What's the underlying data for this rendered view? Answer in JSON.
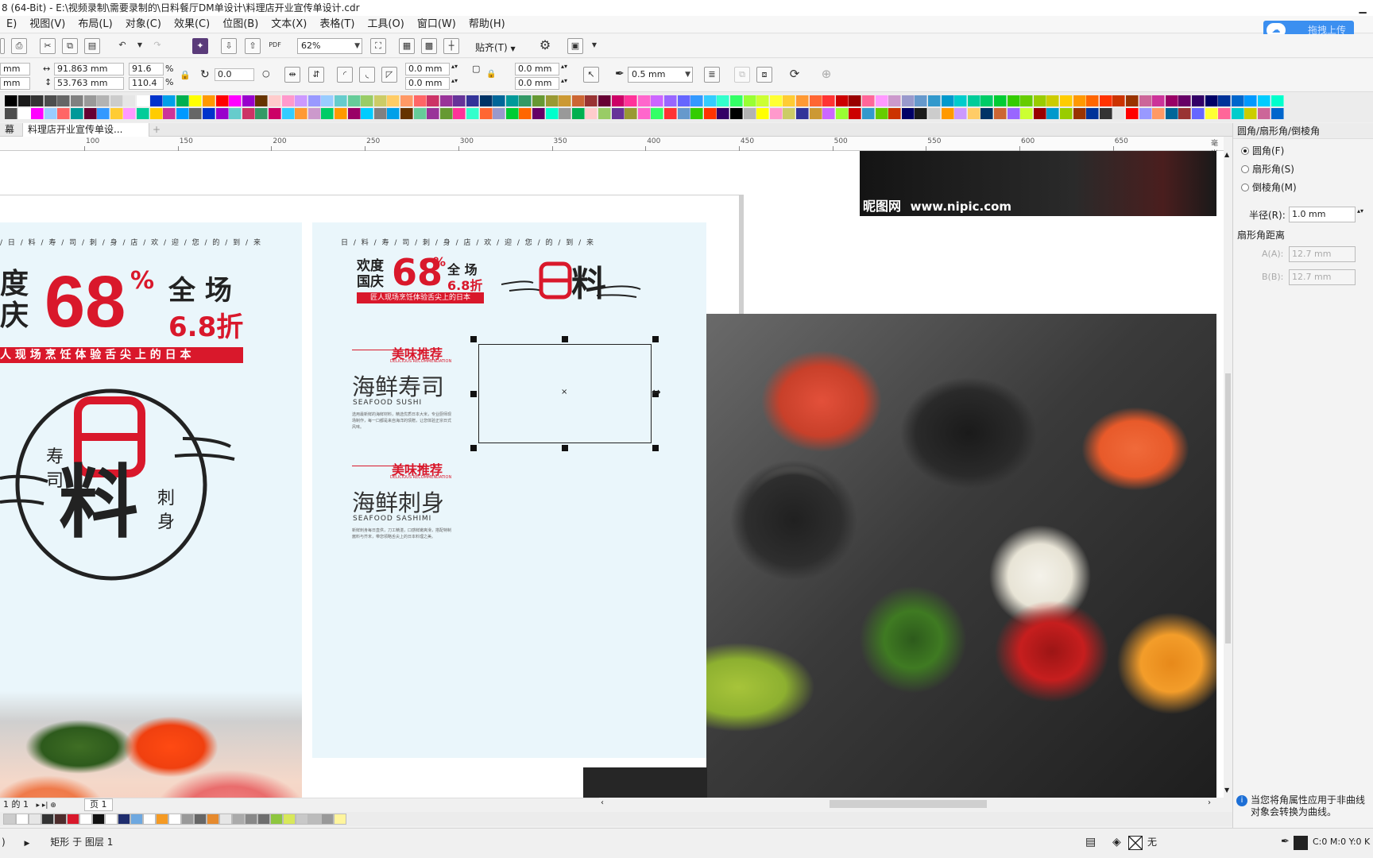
{
  "window": {
    "title": "8 (64-Bit) - E:\\视频录制\\需要录制的\\日料餐厅DM单设计\\料理店开业宣传单设计.cdr"
  },
  "menu": [
    "E)",
    "视图(V)",
    "布局(L)",
    "对象(C)",
    "效果(C)",
    "位图(B)",
    "文本(X)",
    "表格(T)",
    "工具(O)",
    "窗口(W)",
    "帮助(H)"
  ],
  "cloud_button": "拖拽上传",
  "toolbar": {
    "zoom": "62%",
    "snap_label": "贴齐(T)"
  },
  "properties": {
    "x_partial": "mm",
    "y_partial": "mm",
    "width": "91.863 mm",
    "height": "53.763 mm",
    "scale_x": "91.6",
    "scale_y": "110.4",
    "percent": "%",
    "rotation": "0.0",
    "corner_tl": "0.0 mm",
    "corner_bl": "0.0 mm",
    "corner_tr": "0.0 mm",
    "corner_br": "0.0 mm",
    "outline_width": "0.5 mm"
  },
  "colors": {
    "accent_red": "#d9182b",
    "panel_bg": "#eaf6fb",
    "cloud_blue": "#3b8ff0"
  },
  "tabs": {
    "left": "幕",
    "doc": "料理店开业宣传单设..."
  },
  "ruler": {
    "labels": [
      "100",
      "150",
      "200",
      "250",
      "300",
      "350",
      "400",
      "450",
      "500",
      "550",
      "600",
      "650"
    ],
    "unit": "毫米"
  },
  "flyer_left": {
    "date_strip": "/ 日 / 料 / 寿 / 司 / 刺 / 身 / 店 / 欢 / 迎 / 您 / 的 / 到 / 来",
    "line1": "度",
    "line2": "庆",
    "big_number": "68",
    "pct": "%",
    "right_top": "全 场",
    "right_bottom": "6.8折",
    "slogan": "人 现 场 烹 饪 体 验 舌 尖 上 的 日 本",
    "logo_day": "日",
    "logo_liao": "料",
    "logo_left": "寿\n司",
    "logo_right": "刺\n身"
  },
  "flyer_mid": {
    "date_strip": "日 / 料 / 寿 / 司 / 刺 / 身 / 店 / 欢 / 迎 / 您 / 的 / 到 / 来",
    "promo_left_top": "欢度",
    "promo_left_bottom": "国庆",
    "big_number": "68",
    "pct": "%",
    "promo_right_top": "全 场",
    "promo_right_bottom": "6.8折",
    "promo_banner": "匠人现场烹饪体验舌尖上的日本",
    "logo_day": "日",
    "logo_liao": "料",
    "section1_tag": "美味推荐",
    "section1_tag_en": "DELICIOUS RECOMMENDATION",
    "section1_title": "海鲜寿司",
    "section1_en": "SEAFOOD SUSHI",
    "section1_body": "选用最新鲜的海鲜材料，精选优质日本大米，专业厨师现场制作，每一口都是来自海洋的馈赠，让您体验正宗日式风味。",
    "section2_tag": "美味推荐",
    "section2_tag_en": "DELICIOUS RECOMMENDATION",
    "section2_title": "海鲜刺身",
    "section2_en": "SEAFOOD SASHIMI",
    "section2_body": "新鲜刺身每日直供，刀工精湛，口感鲜嫩爽滑，搭配特制酱料与芥末，带您领略舌尖上的日本料理之美。"
  },
  "watermark": {
    "brand": "昵图网",
    "url": "www.nipic.com"
  },
  "docker": {
    "header": "圆角/扇形角/倒棱角",
    "option1": "圆角(F)",
    "option2": "扇形角(S)",
    "option3": "倒棱角(M)",
    "radius_label": "半径(R):",
    "radius_value": "1.0 mm",
    "distance_label": "扇形角距离",
    "a_label": "A(A):",
    "a_value": "12.7 mm",
    "b_label": "B(B):",
    "b_value": "12.7 mm",
    "info_line1": "当您将角属性应用于非曲线",
    "info_line2": "对象会转换为曲线。"
  },
  "pagenav": {
    "page_count": "1 的 1",
    "page_tab": "页 1"
  },
  "status": {
    "left_partial": ")",
    "layer_info": "矩形 于 图层 1",
    "fill_none": "无",
    "color_readout": "C:0 M:0 Y:0 K"
  }
}
